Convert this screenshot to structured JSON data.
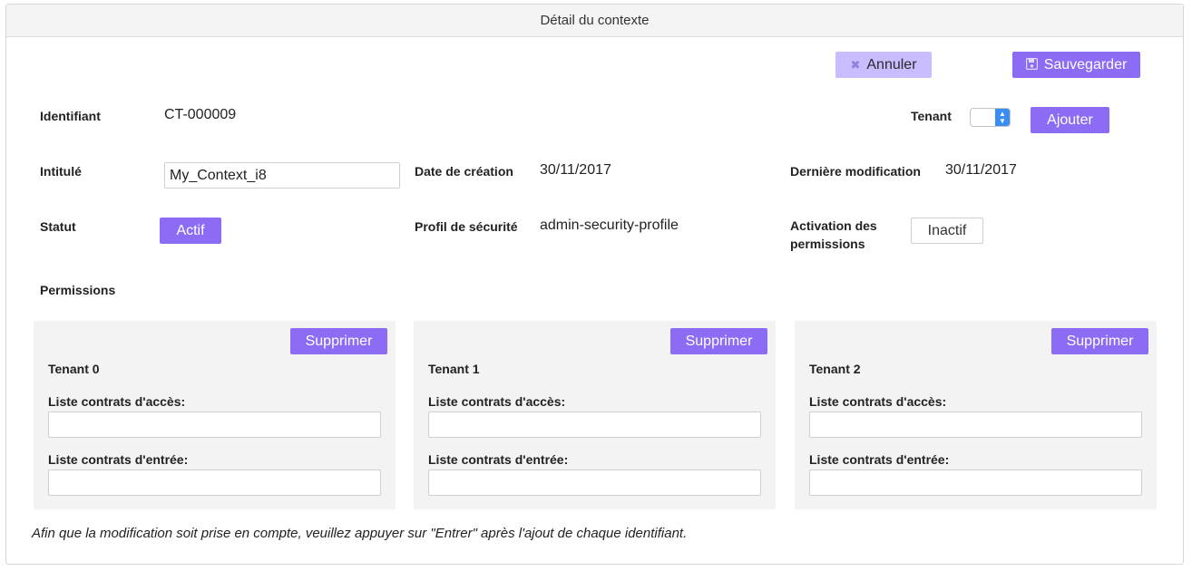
{
  "header": {
    "title": "Détail du contexte"
  },
  "toolbar": {
    "cancel_label": "Annuler",
    "cancel_icon": "close-icon",
    "save_label": "Sauvegarder",
    "save_icon": "floppy-disk-icon"
  },
  "tenant": {
    "label": "Tenant",
    "add_label": "Ajouter"
  },
  "fields": {
    "identifiant": {
      "label": "Identifiant",
      "value": "CT-000009"
    },
    "intitule": {
      "label": "Intitulé",
      "value": "My_Context_i8"
    },
    "date_creation": {
      "label": "Date de création",
      "value": "30/11/2017"
    },
    "derniere_modif": {
      "label": "Dernière modification",
      "value": "30/11/2017"
    },
    "statut": {
      "label": "Statut",
      "value": "Actif"
    },
    "profil_securite": {
      "label": "Profil de sécurité",
      "value": "admin-security-profile"
    },
    "activation_permissions": {
      "label_line1": "Activation des",
      "label_line2": "permissions",
      "value": "Inactif"
    }
  },
  "permissions": {
    "label": "Permissions",
    "tenants": [
      {
        "title": "Tenant 0",
        "delete_label": "Supprimer",
        "access_label": "Liste contrats d'accès:",
        "access_value": "",
        "ingest_label": "Liste contrats d'entrée:",
        "ingest_value": ""
      },
      {
        "title": "Tenant 1",
        "delete_label": "Supprimer",
        "access_label": "Liste contrats d'accès:",
        "access_value": "",
        "ingest_label": "Liste contrats d'entrée:",
        "ingest_value": ""
      },
      {
        "title": "Tenant 2",
        "delete_label": "Supprimer",
        "access_label": "Liste contrats d'accès:",
        "access_value": "",
        "ingest_label": "Liste contrats d'entrée:",
        "ingest_value": ""
      }
    ]
  },
  "footnote": "Afin que la modification soit prise en compte, veuillez appuyer sur \"Entrer\" après l'ajout de chaque identifiant.",
  "colors": {
    "accent": "#8c6cf5",
    "accent_light": "#c9bcff",
    "select_blue": "#3a8ef3",
    "card_bg": "#f3f3f3"
  }
}
